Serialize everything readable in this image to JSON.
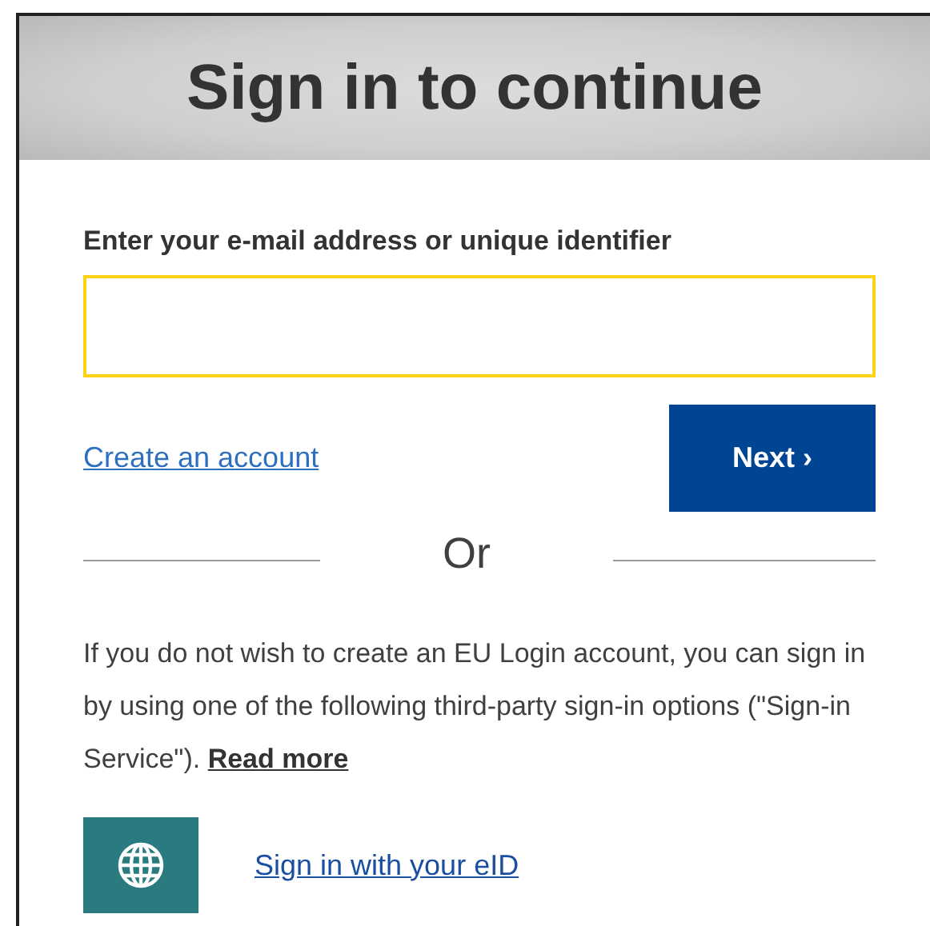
{
  "header": {
    "title": "Sign in to continue"
  },
  "login": {
    "label": "Enter your e-mail address or unique identifier",
    "field": {
      "focused": true
    },
    "create_link": "Create an account",
    "next_button": {
      "label": "Next",
      "chevron": "›"
    }
  },
  "divider": {
    "text": "Or"
  },
  "info": {
    "text": "If you do not wish to create an EU Login account, you can sign in by using one of the following third-party sign-in options (\"Sign-in Service\").",
    "link": "Read more"
  },
  "services": [
    {
      "kind": "eid",
      "label": "Sign in with your eID"
    }
  ]
}
